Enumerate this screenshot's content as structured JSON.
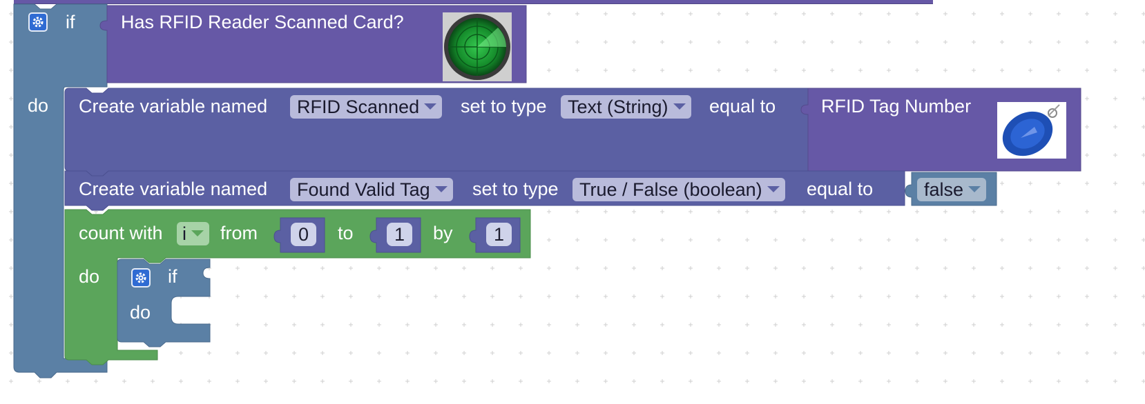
{
  "colors": {
    "control": "#5b80a5",
    "purple": "#6658a6",
    "purple_dark": "#5b60a3",
    "loop": "#5ba55b",
    "logic": "#5b80a5"
  },
  "outer_if": {
    "if_label": "if",
    "do_label": "do",
    "condition": {
      "label": "Has RFID Reader Scanned Card?",
      "image": "rfid-radar-image"
    }
  },
  "statement1": {
    "create_label": "Create variable named",
    "var_name": "RFID Scanned",
    "type_label": "set to type",
    "type_value": "Text (String)",
    "equal_label": "equal to",
    "value_block": {
      "label": "RFID Tag Number",
      "image": "rfid-tag-image"
    }
  },
  "statement2": {
    "create_label": "Create variable named",
    "var_name": "Found Valid Tag",
    "type_label": "set to type",
    "type_value": "True / False (boolean)",
    "equal_label": "equal to",
    "value": "false"
  },
  "count_loop": {
    "count_label": "count with",
    "var": "i",
    "from_label": "from",
    "from_value": "0",
    "to_label": "to",
    "to_value": "1",
    "by_label": "by",
    "by_value": "1",
    "do_label": "do"
  },
  "inner_if": {
    "if_label": "if",
    "do_label": "do"
  }
}
